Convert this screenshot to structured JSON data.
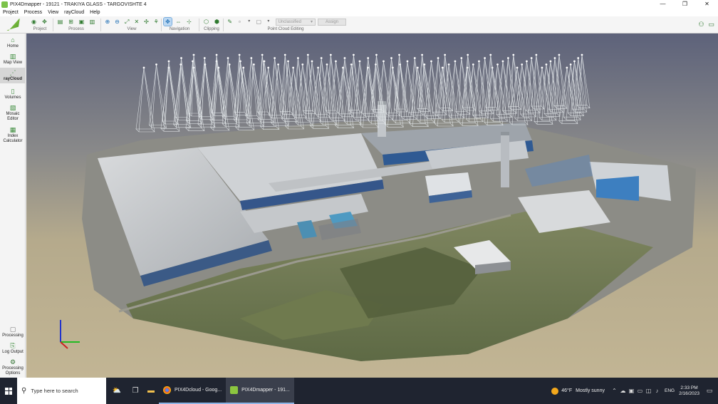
{
  "window": {
    "title": "PIX4Dmapper - 19121 - TRAKIYA GLASS - TARGOVISHTE 4",
    "minimize_glyph": "—",
    "restore_glyph": "❐",
    "close_glyph": "✕"
  },
  "menu": [
    "Project",
    "Process",
    "View",
    "rayCloud",
    "Help"
  ],
  "toolbar": {
    "groups": {
      "project": "Project",
      "process": "Process",
      "view": "View",
      "navigation": "Navigation",
      "clipping": "Clipping",
      "point_cloud_editing": "Point Cloud Editing"
    },
    "class_select_value": "Unclassified",
    "assign_label": "Assign"
  },
  "sidebar": {
    "items": [
      {
        "label": "Home",
        "icon": "home-icon"
      },
      {
        "label": "Map View",
        "icon": "map-icon"
      },
      {
        "label": "rayCloud",
        "icon": "raycloud-icon"
      },
      {
        "label": "Volumes",
        "icon": "volumes-icon"
      },
      {
        "label": "Mosaic Editor",
        "icon": "mosaic-icon"
      },
      {
        "label": "Index Calculator",
        "icon": "index-icon"
      }
    ],
    "bottom_items": [
      {
        "label": "Processing",
        "icon": "processing-icon"
      },
      {
        "label": "Log Output",
        "icon": "log-icon"
      },
      {
        "label": "Processing Options",
        "icon": "gear-icon"
      }
    ]
  },
  "taskbar": {
    "search_placeholder": "Type here to search",
    "apps": [
      {
        "label": "PIX4Dcloud - Goog...",
        "color": "#e8453c"
      },
      {
        "label": "PIX4Dmapper - 191...",
        "color": "#8cc63f"
      }
    ],
    "weather_temp": "46°F",
    "weather_text": "Mostly sunny",
    "language": "ENG",
    "time": "2:33 PM",
    "date": "2/16/2023"
  }
}
